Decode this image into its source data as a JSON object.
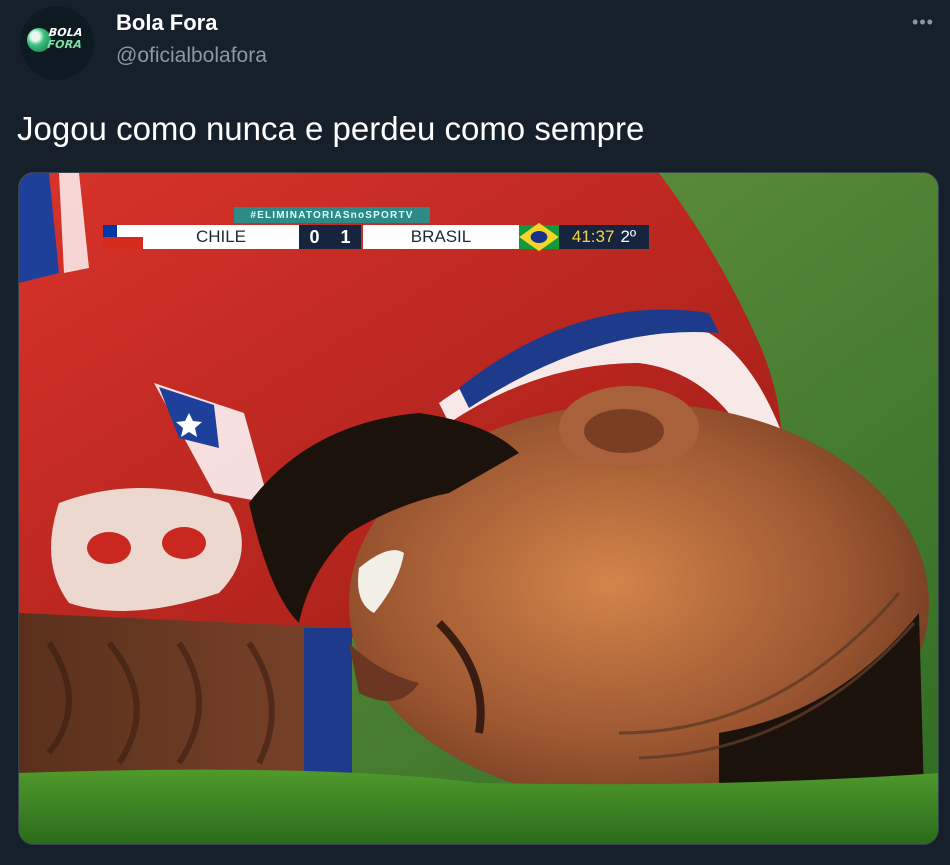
{
  "author": {
    "display_name": "Bola Fora",
    "handle": "@oficialbolafora",
    "avatar_text_line1": "BOLA",
    "avatar_text_line2": "FORA"
  },
  "more_icon": "more-horizontal-icon",
  "more_glyph": "•••",
  "tweet": {
    "text": "Jogou como nunca e perdeu como sempre"
  },
  "scoreboard": {
    "tag": "#ELIMINATORIASnoSPORTV",
    "home_team": "CHILE",
    "home_score": "0",
    "away_score": "1",
    "away_team": "BRASIL",
    "clock": "41:37",
    "period": "2º"
  },
  "colors": {
    "background": "#15202b",
    "handle": "#8899a6",
    "jersey_red": "#c9271f",
    "grass_green": "#3c7a2a"
  }
}
